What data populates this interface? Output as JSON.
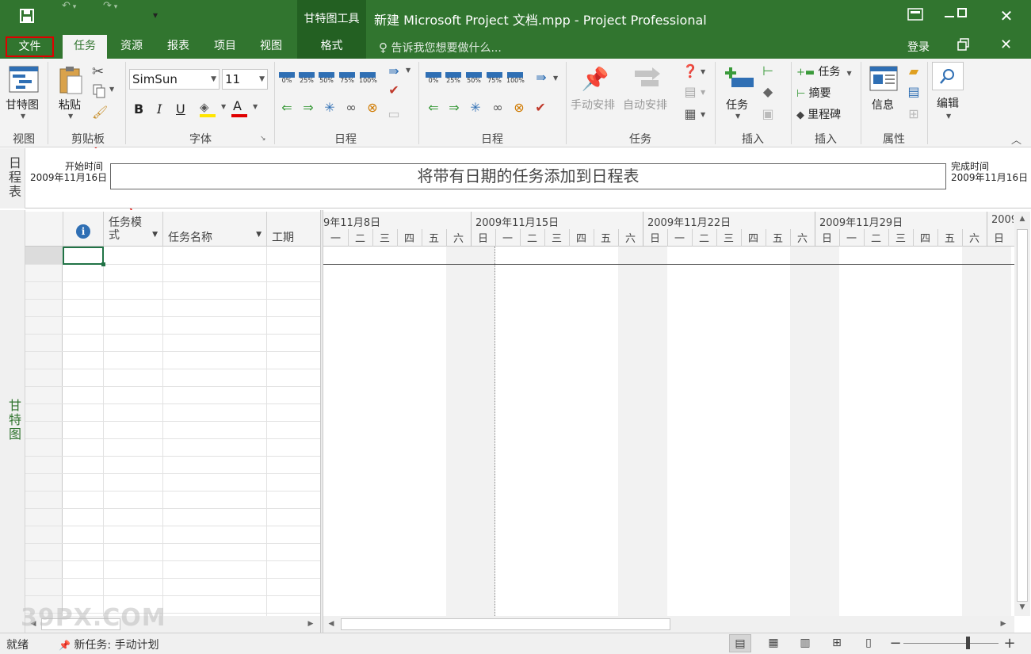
{
  "title_bar": {
    "context_tool": "甘特图工具",
    "document_title": "新建 Microsoft Project 文档.mpp - Project Professional",
    "qa_save_icon": "save-icon",
    "qa_undo_icon": "undo-icon",
    "qa_redo_icon": "redo-icon"
  },
  "tabs": {
    "file": "文件",
    "task": "任务",
    "resource": "资源",
    "report": "报表",
    "project": "项目",
    "view": "视图",
    "format": "格式",
    "tell_me": "告诉我您想要做什么...",
    "sign_in": "登录"
  },
  "ribbon": {
    "view_group": {
      "label": "视图",
      "gantt_button": "甘特图"
    },
    "clipboard_group": {
      "label": "剪贴板",
      "paste_button": "粘贴"
    },
    "font_group": {
      "label": "字体",
      "font_name": "SimSun",
      "font_size": "11",
      "bold": "B",
      "italic": "I",
      "underline": "U",
      "font_color": "A"
    },
    "schedule_group_1": {
      "label": "日程",
      "percents": [
        "0%",
        "25%",
        "50%",
        "75%",
        "100%"
      ]
    },
    "schedule_group_2": {
      "label": "日程",
      "percents": [
        "0%",
        "25%",
        "50%",
        "75%",
        "100%"
      ]
    },
    "tasks_group": {
      "label": "任务",
      "manual": "手动安排",
      "auto": "自动安排"
    },
    "insert_group_1": {
      "label": "插入",
      "task_button": "任务"
    },
    "insert_group_2": {
      "label": "插入",
      "task": "任务",
      "summary": "摘要",
      "milestone": "里程碑"
    },
    "properties_group": {
      "label": "属性",
      "info": "信息"
    },
    "edit_group": {
      "label": "编辑"
    }
  },
  "timeline": {
    "side_label": "日程表",
    "start_label": "开始时间",
    "start_date": "2009年11月16日",
    "finish_label": "完成时间",
    "finish_date": "2009年11月16日",
    "placeholder": "将带有日期的任务添加到日程表"
  },
  "gantt": {
    "side_label": "甘特图",
    "columns": {
      "info_icon": "i",
      "task_mode_1": "任务模",
      "task_mode_2": "式",
      "task_name": "任务名称",
      "duration": "工期"
    },
    "weeks": [
      "9年11月8日",
      "2009年11月15日",
      "2009年11月22日",
      "2009年11月29日",
      "2009"
    ],
    "days": [
      "一",
      "二",
      "三",
      "四",
      "五",
      "六",
      "日",
      "一",
      "二",
      "三",
      "四",
      "五",
      "六",
      "日",
      "一",
      "二",
      "三",
      "四",
      "五",
      "六",
      "日",
      "一",
      "二",
      "三",
      "四",
      "五",
      "六",
      "日"
    ]
  },
  "status_bar": {
    "ready": "就绪",
    "new_tasks": "新任务: 手动计划"
  },
  "watermark": "39PX.COM"
}
